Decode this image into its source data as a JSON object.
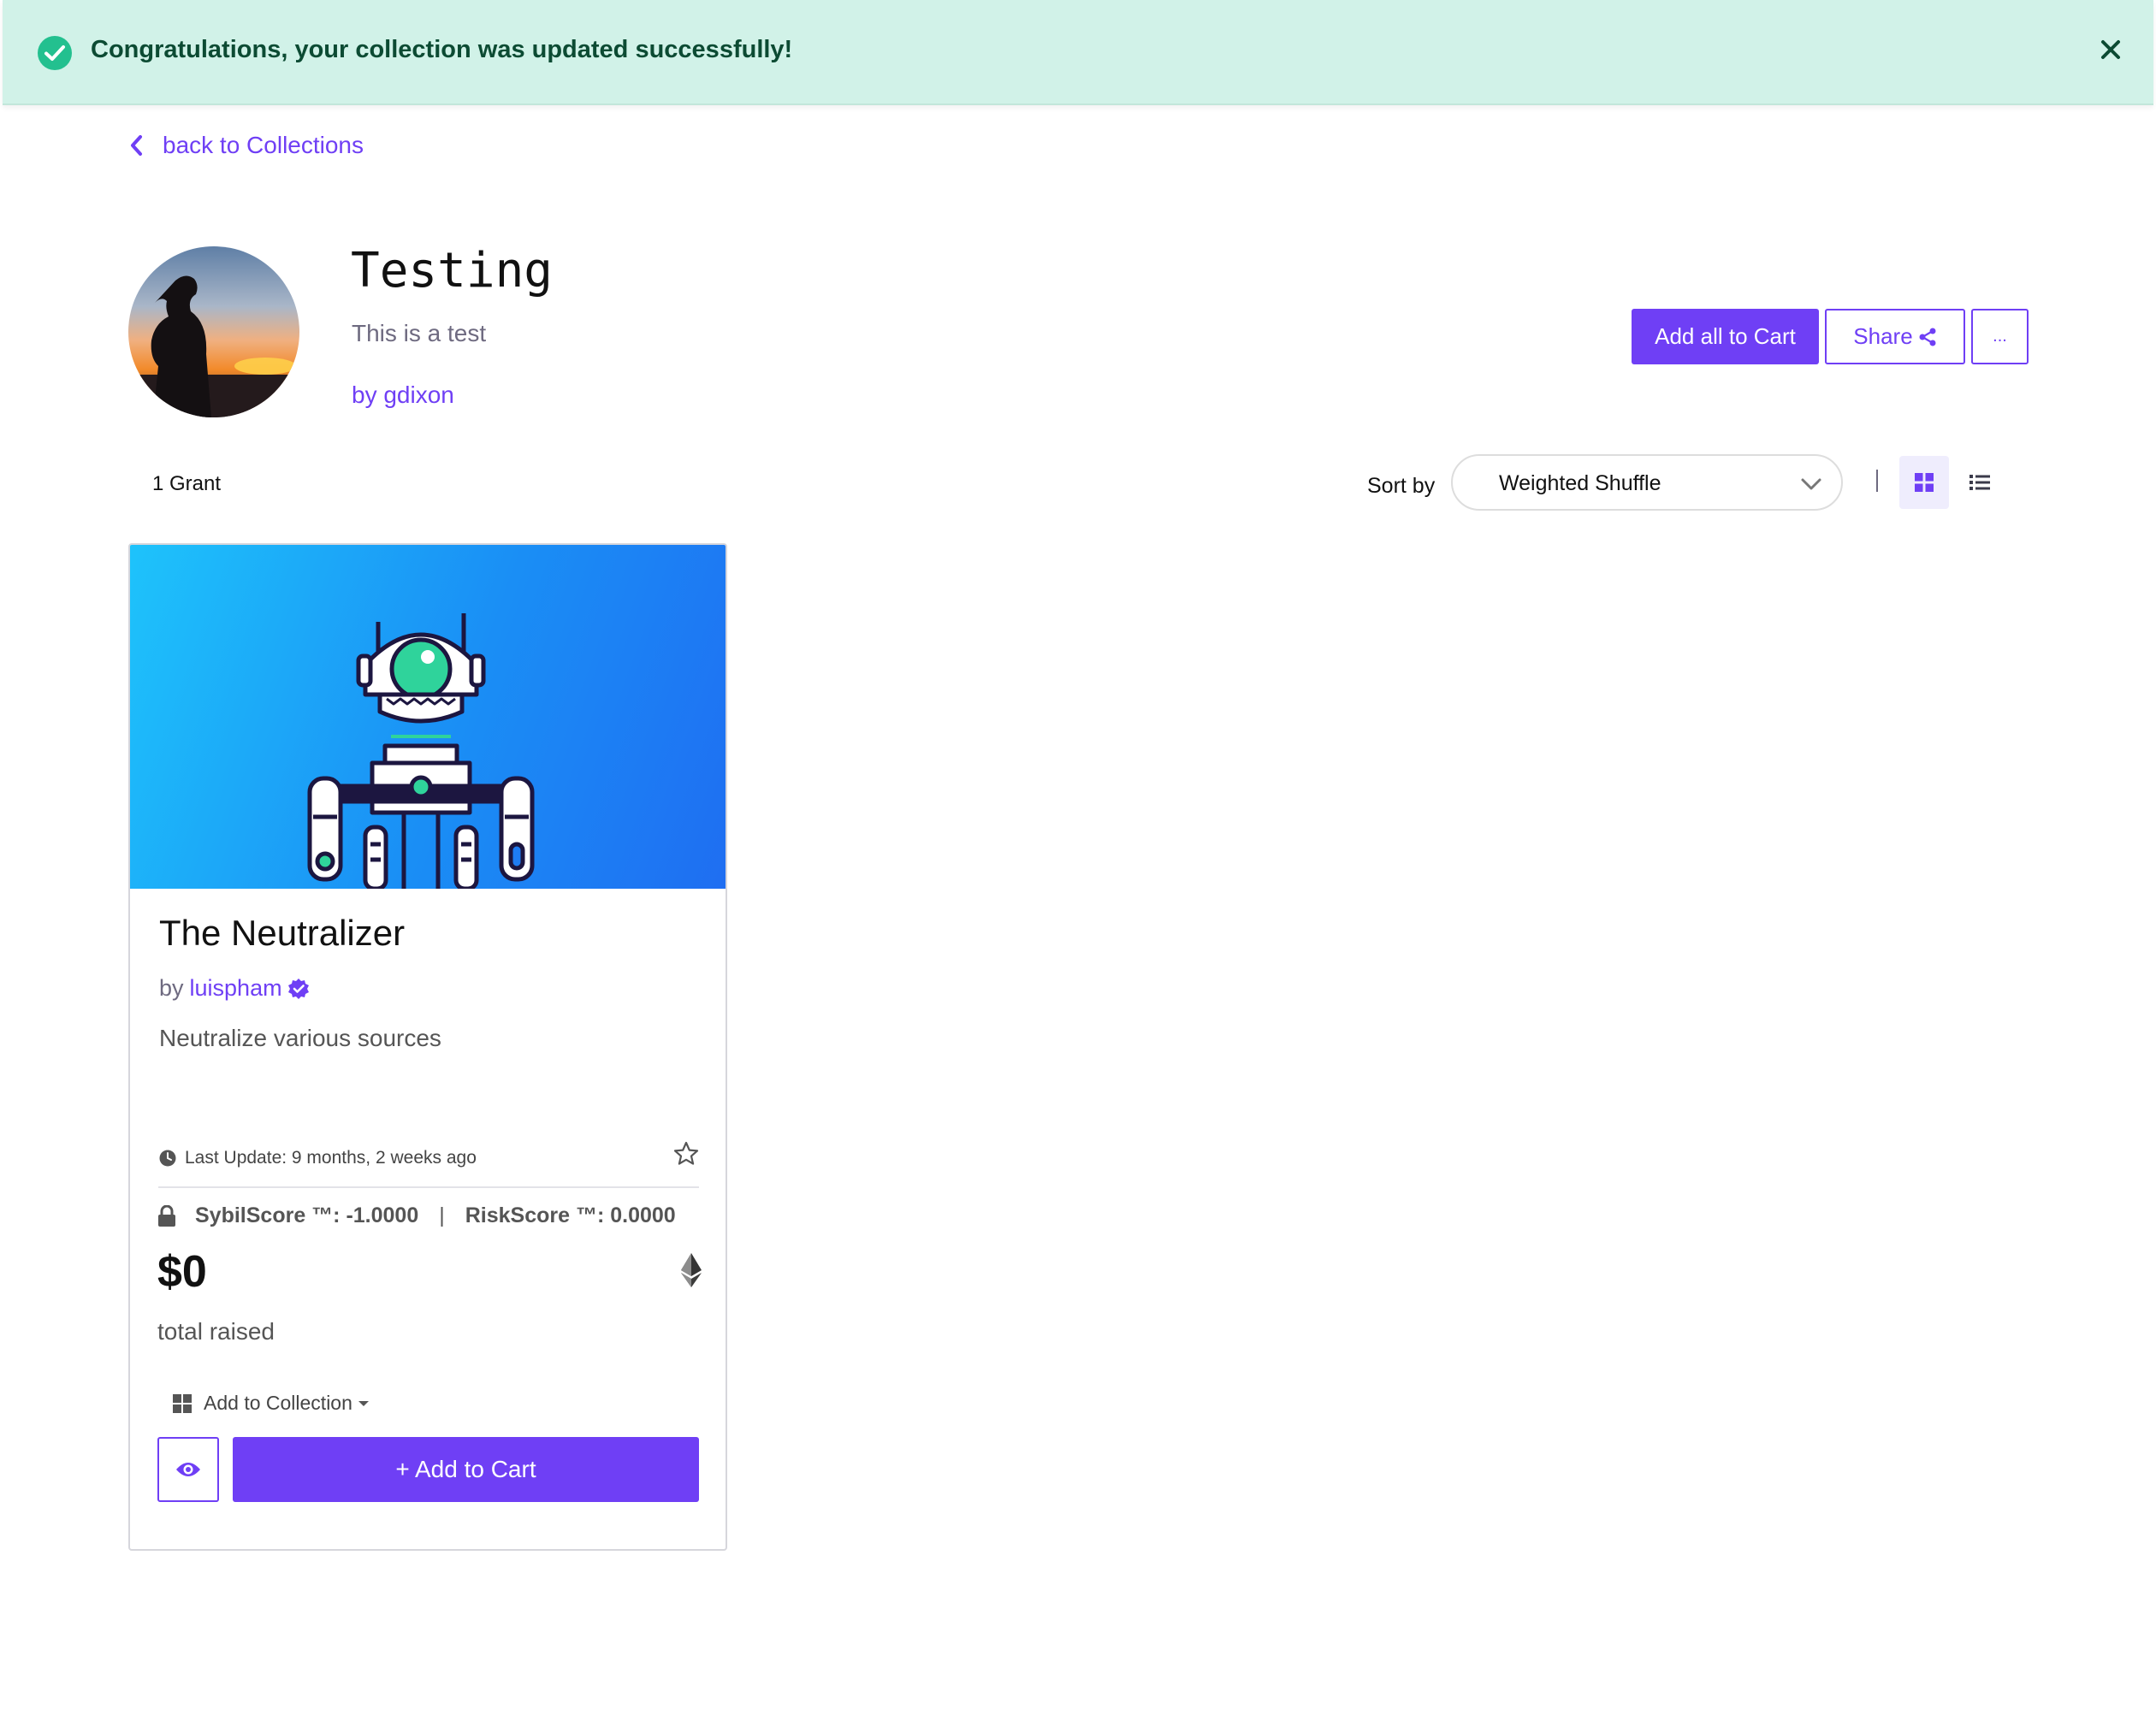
{
  "alert": {
    "message": "Congratulations, your collection was updated successfully!",
    "icons": {
      "status": "check-circle-icon",
      "close": "close-icon"
    },
    "colors": {
      "background": "#d1f2e8",
      "text": "#0c4b33",
      "icon": "#23c08f"
    }
  },
  "nav": {
    "back_label": "back to Collections"
  },
  "collection": {
    "title": "Testing",
    "description": "This is a test",
    "byline": "by gdixon"
  },
  "actions": {
    "add_all_label": "Add all to Cart",
    "share_label": "Share",
    "more_label": "..."
  },
  "listing": {
    "count_label": "1 Grant",
    "sort_label": "Sort by",
    "sort_value": "Weighted Shuffle",
    "view_modes": [
      "grid",
      "list"
    ],
    "active_view": "grid"
  },
  "grant": {
    "name": "The Neutralizer",
    "by_prefix": "by",
    "owner": "luispham",
    "verified": true,
    "description": "Neutralize various sources",
    "last_update": "Last Update: 9 months, 2 weeks ago",
    "sybil_score": "SybilScore ™: -1.0000",
    "separator": "|",
    "risk_score": "RiskScore ™: 0.0000",
    "total_raised": "$0",
    "total_raised_label": "total raised",
    "add_to_collection_label": "Add to Collection",
    "add_to_cart_label": "+ Add to Cart"
  },
  "colors": {
    "accent": "#6f3ff5",
    "muted": "#6e6a80"
  }
}
